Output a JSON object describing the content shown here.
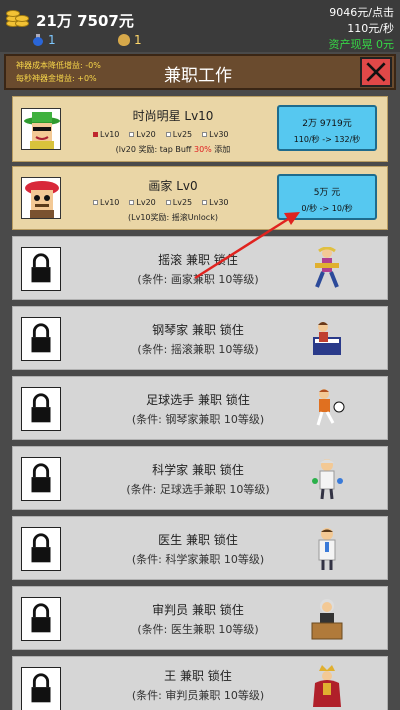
{
  "topbar": {
    "money": "21万 7507元",
    "potion_count": "1",
    "bag_count": "1",
    "click_rate": "9046元/点击",
    "sec_rate": "110元/秒",
    "assets": "资产现晃 0元"
  },
  "panel": {
    "title": "兼职工作",
    "bonus1": "神器成本降低增益: -0%",
    "bonus2": "每秒神器金增益: +0%",
    "close_icon": "close-x-icon"
  },
  "jobs_unlocked": [
    {
      "title": "时尚明星 Lv10",
      "levels": [
        "Lv10",
        "Lv20",
        "Lv25",
        "Lv30"
      ],
      "active_level": 0,
      "reward_pre": "(lv20 奖励: tap Buff ",
      "reward_hl": "30%",
      "reward_post": " 添加",
      "buy_cost": "2万 9719元",
      "buy_rate": "110/秒 -> 132/秒"
    },
    {
      "title": "画家 Lv0",
      "levels": [
        "Lv10",
        "Lv20",
        "Lv25",
        "Lv30"
      ],
      "active_level": -1,
      "reward_pre": "(Lv10奖励: 摇滚Unlock)",
      "reward_hl": "",
      "reward_post": "",
      "buy_cost": "5万 元",
      "buy_rate": "0/秒 -> 10/秒"
    }
  ],
  "jobs_locked": [
    {
      "title": "摇滚 兼职 锁住",
      "cond": "(条件: 画家兼职 10等级)",
      "icon": "rocker-icon"
    },
    {
      "title": "钢琴家 兼职 锁住",
      "cond": "(条件: 摇滚兼职 10等级)",
      "icon": "pianist-icon"
    },
    {
      "title": "足球选手 兼职 锁住",
      "cond": "(条件: 钢琴家兼职 10等级)",
      "icon": "soccer-player-icon"
    },
    {
      "title": "科学家 兼职 锁住",
      "cond": "(条件: 足球选手兼职 10等级)",
      "icon": "scientist-icon"
    },
    {
      "title": "医生 兼职 锁住",
      "cond": "(条件: 科学家兼职 10等级)",
      "icon": "doctor-icon"
    },
    {
      "title": "审判员 兼职 锁住",
      "cond": "(条件: 医生兼职 10等级)",
      "icon": "judge-icon"
    },
    {
      "title": "王 兼职 锁住",
      "cond": "(条件: 审判员兼职 10等级)",
      "icon": "king-icon"
    }
  ]
}
